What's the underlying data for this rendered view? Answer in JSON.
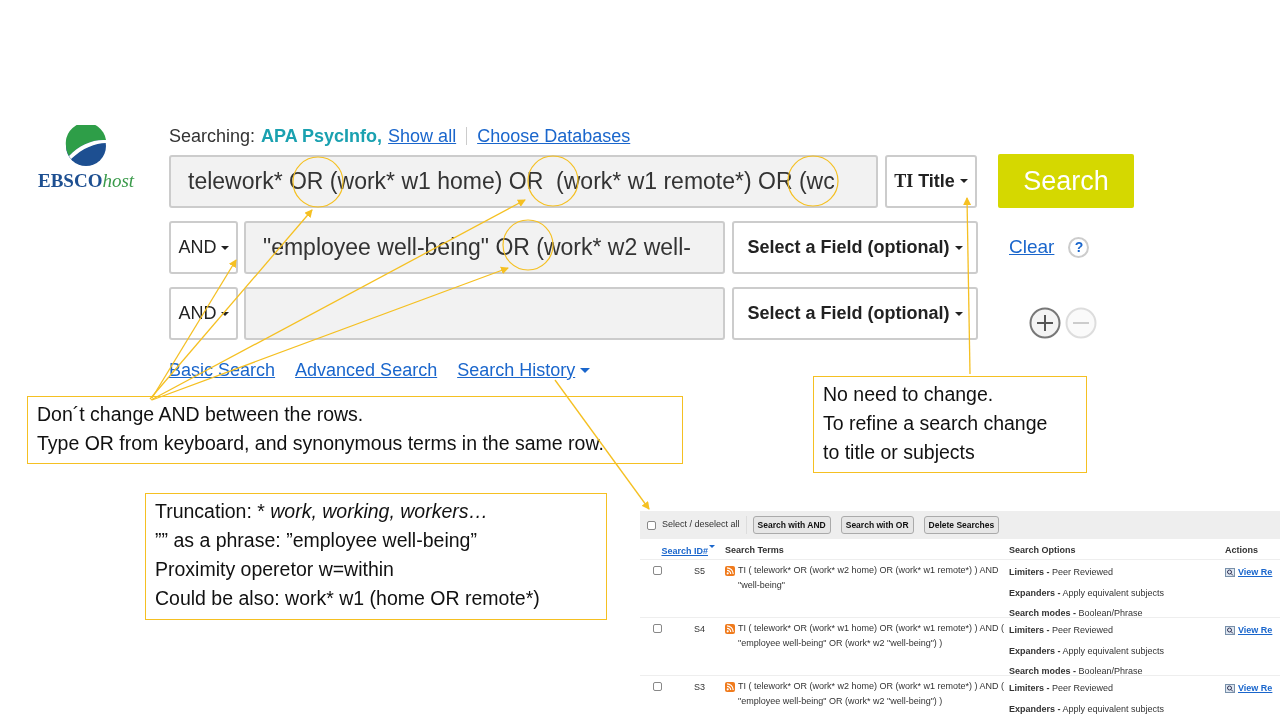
{
  "search": {
    "logo": {
      "brand": "EBSCO",
      "suffix": "host"
    },
    "searching_label": "Searching:",
    "database": "APA PsycInfo,",
    "show_all": "Show all",
    "choose_databases": "Choose Databases",
    "rows": [
      {
        "query": "telework* OR (work* w1 home) OR  (work* w1 remote*) OR (wc",
        "field_code": "TI",
        "field": "Title"
      },
      {
        "operator": "AND",
        "query": "\"employee well-being\" OR (work* w2 well-",
        "field": "Select a Field (optional)"
      },
      {
        "operator": "AND",
        "field": "Select a Field (optional)"
      }
    ],
    "search_button": "Search",
    "clear": "Clear",
    "help": "?",
    "links": [
      {
        "label": "Basic Search",
        "dropdown": false
      },
      {
        "label": "Advanced Search",
        "dropdown": false
      },
      {
        "label": "Search History",
        "dropdown": true
      }
    ]
  },
  "callouts": [
    {
      "lines": [
        "Don´t change AND between the rows.",
        "Type OR from keyboard, and synonymous terms in the same row."
      ]
    },
    {
      "lines": [
        "Truncation: * *work, working, workers…*",
        "”” as a phrase: ”employee well-being”",
        "Proximity operetor w=within",
        "Could be also: work* w1 (home OR remote*)"
      ]
    },
    {
      "lines": [
        "No need to change.",
        "To refine a search change",
        "to title or subjects"
      ]
    }
  ],
  "history": {
    "select_all": {
      "label": "Select / deselect all",
      "checked": false
    },
    "buttons": [
      "Search with AND",
      "Search with OR",
      "Delete Searches"
    ],
    "columns": [
      "Search ID#",
      "Search Terms",
      "Search Options",
      "Actions"
    ],
    "rows": [
      {
        "checked": false,
        "id": "S5",
        "terms": "TI ( telework* OR (work* w2 home) OR (work* w1 remote*) ) AND \"well-being\"",
        "options": [
          "**Limiters -** Peer Reviewed",
          "**Expanders -** Apply equivalent subjects",
          "**Search modes -** Boolean/Phrase"
        ],
        "action": "View Re"
      },
      {
        "checked": false,
        "id": "S4",
        "terms": "TI ( telework* OR (work* w1 home) OR (work* w1 remote*) ) AND ( \"employee well-being\" OR (work* w2 \"well-being\") )",
        "options": [
          "**Limiters -** Peer Reviewed",
          "**Expanders -** Apply equivalent subjects",
          "**Search modes -** Boolean/Phrase"
        ],
        "action": "View Re"
      },
      {
        "checked": false,
        "id": "S3",
        "terms": "TI ( telework* OR (work* w2 home) OR (work* w1 remote*) ) AND ( \"employee well-being\" OR (work* w2 \"well-being\") )",
        "options": [
          "**Limiters -** Peer Reviewed",
          "**Expanders -** Apply equivalent subjects"
        ],
        "action": "View Re"
      }
    ]
  }
}
